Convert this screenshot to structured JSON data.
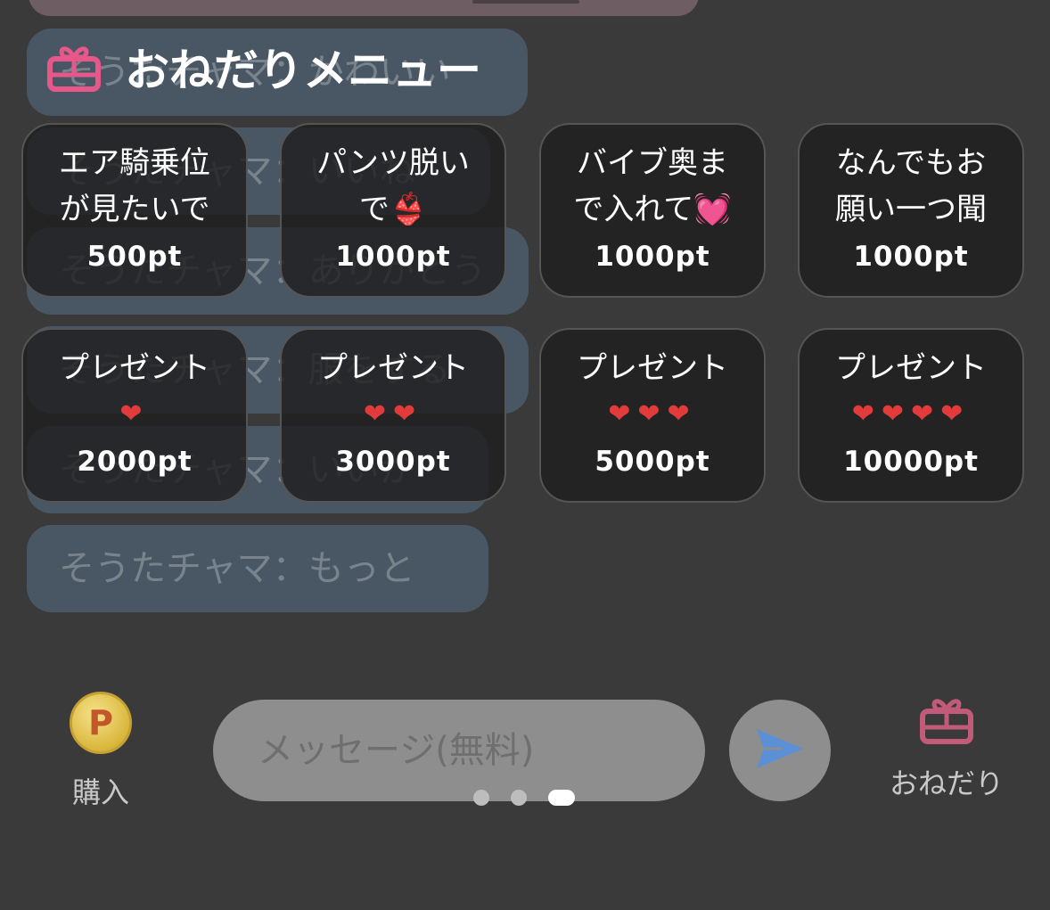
{
  "chat_messages": [
    "そうたチャマ：かわいい",
    "そうたチャマ：いいね",
    "そうたチャマ：ありがとう",
    "そうたチャマ：服をする",
    "そうたチャマ：いいか",
    "そうたチャマ：もっと"
  ],
  "menu": {
    "title": "おねだりメニュー",
    "icon": "gift-icon",
    "items": [
      {
        "label": "エア騎乗位\nが見たいで",
        "hearts": "",
        "points": "500pt"
      },
      {
        "label": "パンツ脱い\nで👙",
        "hearts": "",
        "points": "1000pt"
      },
      {
        "label": "バイブ奥ま\nで入れて💓",
        "hearts": "",
        "points": "1000pt"
      },
      {
        "label": "なんでもお\n願い一つ聞",
        "hearts": "",
        "points": "1000pt"
      },
      {
        "label": "プレゼント",
        "hearts": "❤",
        "points": "2000pt"
      },
      {
        "label": "プレゼント",
        "hearts": "❤❤",
        "points": "3000pt"
      },
      {
        "label": "プレゼント",
        "hearts": "❤❤❤",
        "points": "5000pt"
      },
      {
        "label": "プレゼント",
        "hearts": "❤❤❤❤",
        "points": "10000pt"
      }
    ]
  },
  "bottom_bar": {
    "buy_label": "購入",
    "coin_letter": "P",
    "message_placeholder": "メッセージ(無料)",
    "send_icon": "send-icon",
    "onedari_label": "おねだり",
    "onedari_icon": "gift-icon"
  },
  "colors": {
    "background": "#3a3a3a",
    "chat_bubble": "#4a5967",
    "tile": "#1e1e1e",
    "gift_pink": "#e8578a",
    "send_blue": "#5b8fd6",
    "heart_red": "#e33b3b"
  },
  "pager": {
    "count": 3,
    "active": 3
  }
}
